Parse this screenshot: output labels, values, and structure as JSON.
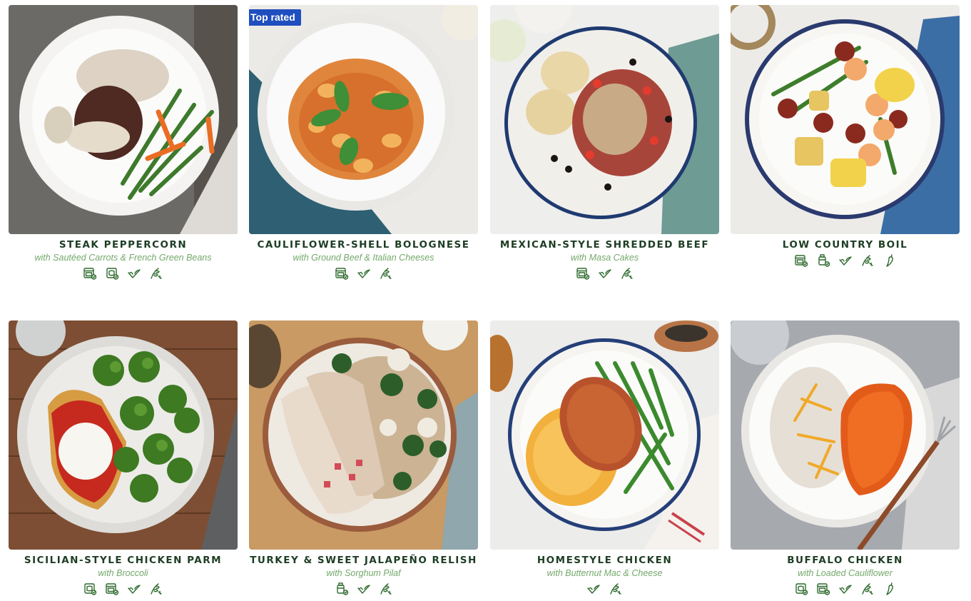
{
  "meals": [
    {
      "title": "STEAK PEPPERCORN",
      "subtitle": "with Sautéed Carrots & French Green Beans",
      "badge": "",
      "icons": [
        "oven-icon",
        "microwave-icon",
        "check-leaf-icon",
        "carb-leaf-icon"
      ]
    },
    {
      "title": "CAULIFLOWER-SHELL BOLOGNESE",
      "subtitle": "with Ground Beef & Italian Cheeses",
      "badge": "Top rated",
      "icons": [
        "oven-icon",
        "check-leaf-icon",
        "carb-leaf-icon"
      ]
    },
    {
      "title": "MEXICAN-STYLE SHREDDED BEEF",
      "subtitle": "with Masa Cakes",
      "badge": "",
      "icons": [
        "oven-icon",
        "check-leaf-icon",
        "carb-leaf-icon"
      ]
    },
    {
      "title": "LOW COUNTRY BOIL",
      "subtitle": "",
      "badge": "",
      "icons": [
        "oven-icon",
        "pan-icon",
        "check-leaf-icon",
        "carb-leaf-icon",
        "pepper-icon"
      ]
    },
    {
      "title": "SICILIAN-STYLE CHICKEN PARM",
      "subtitle": "with Broccoli",
      "badge": "",
      "icons": [
        "microwave-icon",
        "oven-icon",
        "check-leaf-icon",
        "carb-leaf-icon"
      ]
    },
    {
      "title": "TURKEY & SWEET JALAPEÑO RELISH",
      "subtitle": "with Sorghum Pilaf",
      "badge": "",
      "icons": [
        "pan-icon",
        "check-leaf-icon",
        "carb-leaf-icon"
      ]
    },
    {
      "title": "HOMESTYLE CHICKEN",
      "subtitle": "with Butternut Mac & Cheese",
      "badge": "",
      "icons": [
        "check-leaf-icon",
        "carb-leaf-icon"
      ]
    },
    {
      "title": "BUFFALO CHICKEN",
      "subtitle": "with Loaded Cauliflower",
      "badge": "",
      "icons": [
        "microwave-icon",
        "oven-icon",
        "check-leaf-icon",
        "carb-leaf-icon",
        "pepper-icon"
      ]
    }
  ],
  "colors": {
    "title": "#1d3d23",
    "subtitle": "#74a86b",
    "icon": "#2f6b2e",
    "badge": "#1f4fbf"
  }
}
